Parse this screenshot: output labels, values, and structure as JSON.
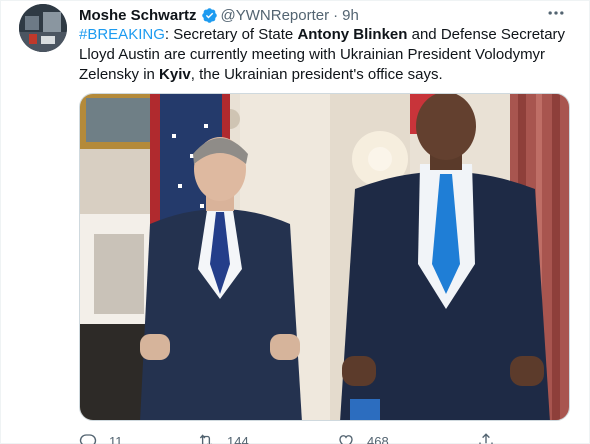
{
  "author": {
    "name": "Moshe Schwartz",
    "handle": "@YWNReporter",
    "time": "9h",
    "separator": "·"
  },
  "tweet": {
    "hashtag": "#BREAKING",
    "part1": ": Secretary of State ",
    "name1": "Antony Blinken",
    "part2": " and Defense Secretary Lloyd Austin are currently meeting with Ukrainian President Volodymyr Zelensky in ",
    "place": "Kyiv",
    "part3": ", the Ukrainian president's office says."
  },
  "actions": {
    "replies": "11",
    "retweets": "144",
    "likes": "468"
  },
  "icons": {
    "verified": "verified-badge-icon",
    "more": "more-icon",
    "reply": "reply-icon",
    "retweet": "retweet-icon",
    "like": "heart-icon",
    "share": "share-icon"
  },
  "colors": {
    "accent": "#1d9bf0",
    "text": "#0f1419",
    "secondary": "#536471"
  }
}
